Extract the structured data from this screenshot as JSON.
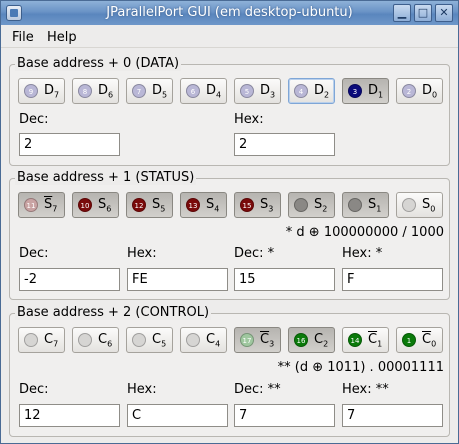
{
  "window": {
    "title": "JParallelPort GUI  (em desktop-ubuntu)",
    "controls": {
      "minimize": "▁",
      "maximize": "□",
      "close": "✕"
    }
  },
  "menubar": {
    "file": "File",
    "help": "Help"
  },
  "data_register": {
    "title": "Base address + 0 (DATA)",
    "bits": [
      {
        "num": "9",
        "name": "D",
        "sub": "7",
        "overline": false,
        "pressed": false,
        "led_color": "#b9b7d6"
      },
      {
        "num": "8",
        "name": "D",
        "sub": "6",
        "overline": false,
        "pressed": false,
        "led_color": "#b9b7d6"
      },
      {
        "num": "7",
        "name": "D",
        "sub": "5",
        "overline": false,
        "pressed": false,
        "led_color": "#b9b7d6"
      },
      {
        "num": "6",
        "name": "D",
        "sub": "4",
        "overline": false,
        "pressed": false,
        "led_color": "#b9b7d6"
      },
      {
        "num": "5",
        "name": "D",
        "sub": "3",
        "overline": false,
        "pressed": false,
        "led_color": "#b9b7d6"
      },
      {
        "num": "4",
        "name": "D",
        "sub": "2",
        "overline": false,
        "pressed": false,
        "led_color": "#b9b7d6",
        "focused": true
      },
      {
        "num": "3",
        "name": "D",
        "sub": "1",
        "overline": false,
        "pressed": true,
        "led_color": "#0b0b7a"
      },
      {
        "num": "2",
        "name": "D",
        "sub": "0",
        "overline": false,
        "pressed": false,
        "led_color": "#b9b7d6"
      }
    ],
    "dec_label": "Dec:",
    "hex_label": "Hex:",
    "dec_value": "2",
    "hex_value": "2"
  },
  "status_register": {
    "title": "Base address + 1 (STATUS)",
    "bits": [
      {
        "num": "11",
        "name": "S",
        "sub": "7",
        "overline": true,
        "pressed": true,
        "led_color": "#c9a3a3"
      },
      {
        "num": "10",
        "name": "S",
        "sub": "6",
        "overline": false,
        "pressed": true,
        "led_color": "#7a0a0a"
      },
      {
        "num": "12",
        "name": "S",
        "sub": "5",
        "overline": false,
        "pressed": true,
        "led_color": "#7a0a0a"
      },
      {
        "num": "13",
        "name": "S",
        "sub": "4",
        "overline": false,
        "pressed": true,
        "led_color": "#7a0a0a"
      },
      {
        "num": "15",
        "name": "S",
        "sub": "3",
        "overline": false,
        "pressed": true,
        "led_color": "#7a0a0a"
      },
      {
        "num": "",
        "name": "S",
        "sub": "2",
        "overline": false,
        "pressed": true,
        "led_color": "#8a8885"
      },
      {
        "num": "",
        "name": "S",
        "sub": "1",
        "overline": false,
        "pressed": true,
        "led_color": "#8a8885"
      },
      {
        "num": "",
        "name": "S",
        "sub": "0",
        "overline": false,
        "pressed": false,
        "led_color": "#d6d5d3"
      }
    ],
    "note": "* d ⊕ 100000000 / 1000",
    "dec_label": "Dec:",
    "hex_label": "Hex:",
    "dec2_label": "Dec: *",
    "hex2_label": "Hex: *",
    "dec_value": "-2",
    "hex_value": "FE",
    "dec2_value": "15",
    "hex2_value": "F"
  },
  "control_register": {
    "title": "Base address + 2 (CONTROL)",
    "bits": [
      {
        "num": "",
        "name": "C",
        "sub": "7",
        "overline": false,
        "pressed": false,
        "led_color": "#d6d5d3"
      },
      {
        "num": "",
        "name": "C",
        "sub": "6",
        "overline": false,
        "pressed": false,
        "led_color": "#d6d5d3"
      },
      {
        "num": "",
        "name": "C",
        "sub": "5",
        "overline": false,
        "pressed": false,
        "led_color": "#d6d5d3"
      },
      {
        "num": "",
        "name": "C",
        "sub": "4",
        "overline": false,
        "pressed": false,
        "led_color": "#d6d5d3"
      },
      {
        "num": "17",
        "name": "C",
        "sub": "3",
        "overline": true,
        "pressed": true,
        "led_color": "#9fc79f"
      },
      {
        "num": "16",
        "name": "C",
        "sub": "2",
        "overline": false,
        "pressed": true,
        "led_color": "#0a7a0a"
      },
      {
        "num": "14",
        "name": "C",
        "sub": "1",
        "overline": true,
        "pressed": false,
        "led_color": "#0a7a0a"
      },
      {
        "num": "1",
        "name": "C",
        "sub": "0",
        "overline": true,
        "pressed": false,
        "led_color": "#0a7a0a"
      }
    ],
    "note": "** (d ⊕ 1011) . 00001111",
    "dec_label": "Dec:",
    "hex_label": "Hex:",
    "dec2_label": "Dec: **",
    "hex2_label": "Hex: **",
    "dec_value": "12",
    "hex_value": "C",
    "dec2_value": "7",
    "hex2_value": "7"
  }
}
